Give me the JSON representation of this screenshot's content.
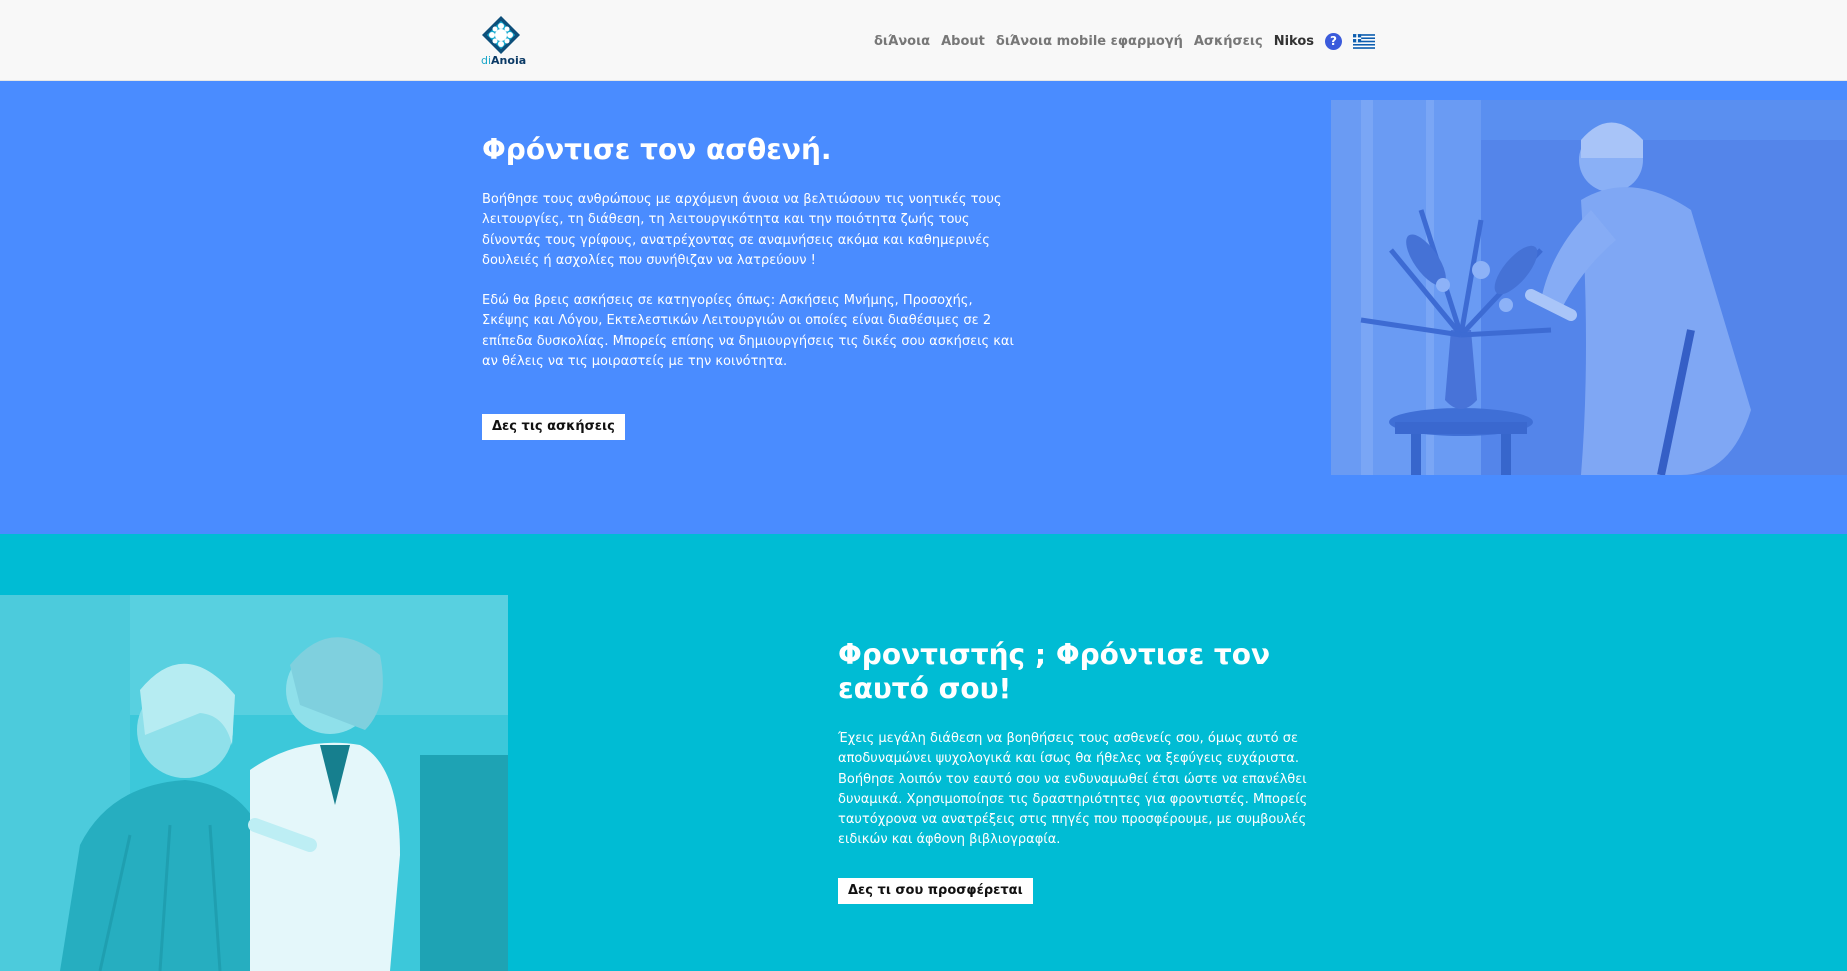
{
  "header": {
    "logo_text_a": "di",
    "logo_text_b": "Anoia",
    "nav": {
      "dianoia": "διΆνοια",
      "about": "About",
      "mobile_app": "διΆνοια mobile εφαρμογή",
      "exercises": "Ασκήσεις",
      "user": "Nikos",
      "help_glyph": "?"
    },
    "icons": [
      "logo-icon",
      "help-icon",
      "greek-flag-icon"
    ]
  },
  "hero_patient": {
    "title": "Φρόντισε τον ασθενή.",
    "paragraph_1": "Βοήθησε τους ανθρώπους με αρχόμενη άνοια να βελτιώσουν τις νοητικές τους λειτουργίες, τη διάθεση, τη λειτουργικότητα και την ποιότητα ζωής τους δίνοντάς τους γρίφους, ανατρέχοντας σε αναμνήσεις ακόμα και καθημερινές δουλειές ή ασχολίες που συνήθιζαν να λατρεύουν !",
    "paragraph_2": "Εδώ θα βρεις ασκήσεις σε κατηγορίες όπως: Ασκήσεις Μνήμης, Προσοχής, Σκέψης και Λόγου, Εκτελεστικών Λειτουργιών οι οποίες είναι διαθέσιμες σε 2 επίπεδα δυσκολίας. Μπορείς επίσης να δημιουργήσεις τις δικές σου ασκήσεις και αν θέλεις να τις μοιραστείς με την κοινότητα.",
    "button_label": "Δες τις ασκήσεις",
    "background_color": "#4a8cff"
  },
  "hero_caregiver": {
    "title": "Φροντιστής ; Φρόντισε τον εαυτό σου!",
    "paragraph_1": "Έχεις μεγάλη διάθεση να βοηθήσεις τους ασθενείς σου, όμως αυτό σε αποδυναμώνει ψυχολογικά και ίσως θα ήθελες να ξεφύγεις ευχάριστα. Βοήθησε λοιπόν τον εαυτό σου να ενδυναμωθεί έτσι ώστε να επανέλθει δυναμικά. Χρησιμοποίησε τις δραστηριότητες για φροντιστές. Μπορείς ταυτόχρονα να ανατρέξεις στις πηγές που προσφέρουμε, με συμβουλές ειδικών και άφθονη βιβλιογραφία.",
    "button_label": "Δες τι σου προσφέρεται",
    "background_color": "#00bcd4"
  }
}
